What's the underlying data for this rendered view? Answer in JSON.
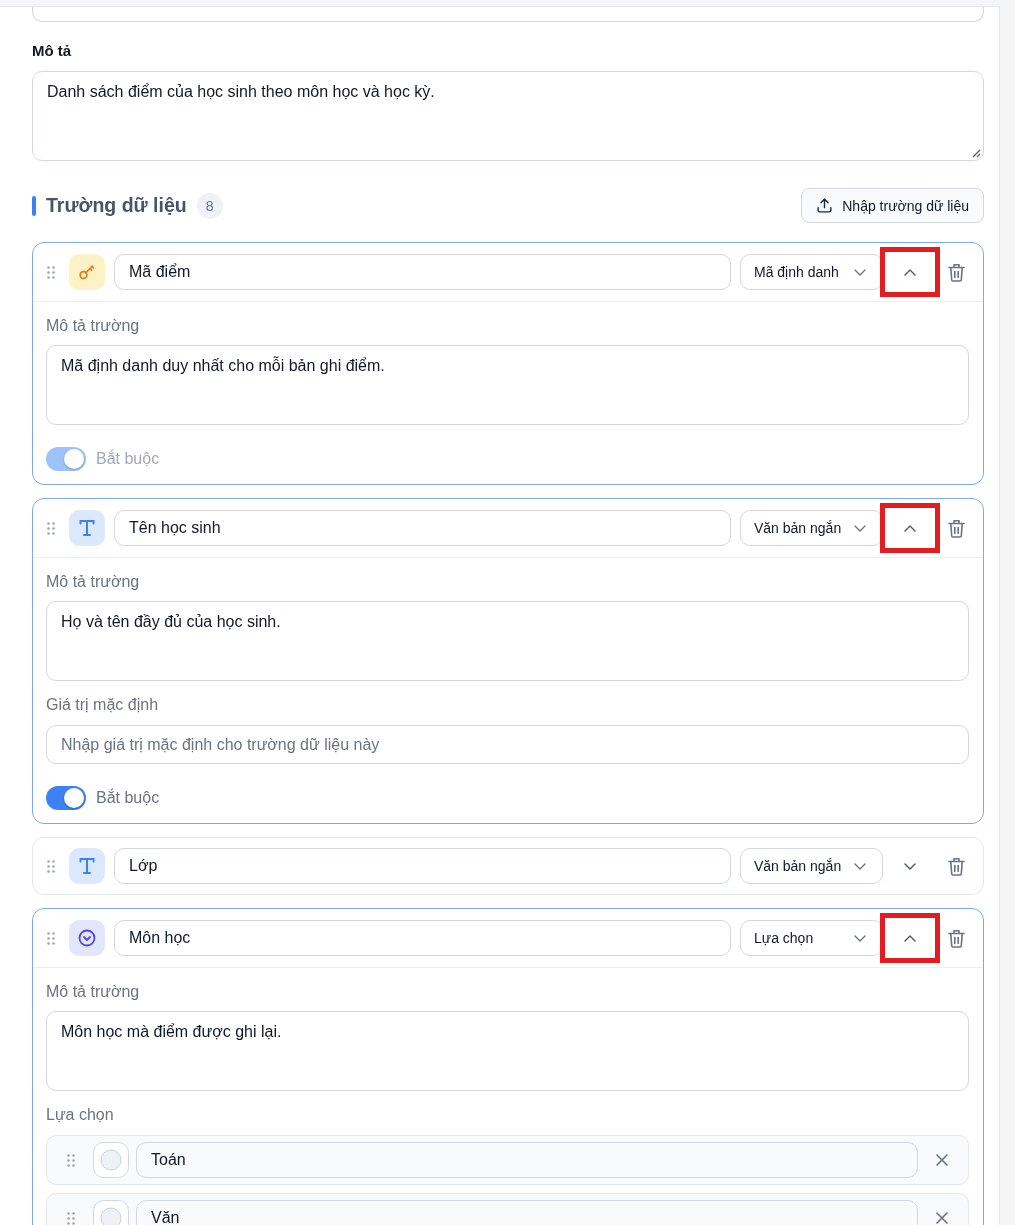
{
  "description": {
    "label": "Mô tả",
    "value": "Danh sách điểm của học sinh theo môn học và học kỳ."
  },
  "fields_section": {
    "title": "Trường dữ liệu",
    "count": "8",
    "import_button": "Nhập trường dữ liệu"
  },
  "fields": [
    {
      "kind": "key",
      "name": "Mã điểm",
      "type": "Mã định danh",
      "expanded": true,
      "highlighted": true,
      "description_label": "Mô tả trường",
      "description": "Mã định danh duy nhất cho mỗi bản ghi điểm.",
      "required": {
        "label": "Bắt buộc",
        "on": true,
        "disabled": true
      }
    },
    {
      "kind": "text",
      "name": "Tên học sinh",
      "type": "Văn bản ngắn",
      "expanded": true,
      "highlighted": true,
      "description_label": "Mô tả trường",
      "description": "Họ và tên đầy đủ của học sinh.",
      "default_label": "Giá trị mặc định",
      "default_placeholder": "Nhập giá trị mặc định cho trường dữ liệu này",
      "required": {
        "label": "Bắt buộc",
        "on": true,
        "disabled": false
      }
    },
    {
      "kind": "text",
      "name": "Lớp",
      "type": "Văn bản ngắn",
      "expanded": false,
      "highlighted": false
    },
    {
      "kind": "choice",
      "name": "Môn học",
      "type": "Lựa chọn",
      "expanded": true,
      "highlighted": true,
      "description_label": "Mô tả trường",
      "description": "Môn học mà điểm được ghi lại.",
      "options_label": "Lựa chọn",
      "options": [
        "Toán",
        "Văn"
      ]
    }
  ]
}
